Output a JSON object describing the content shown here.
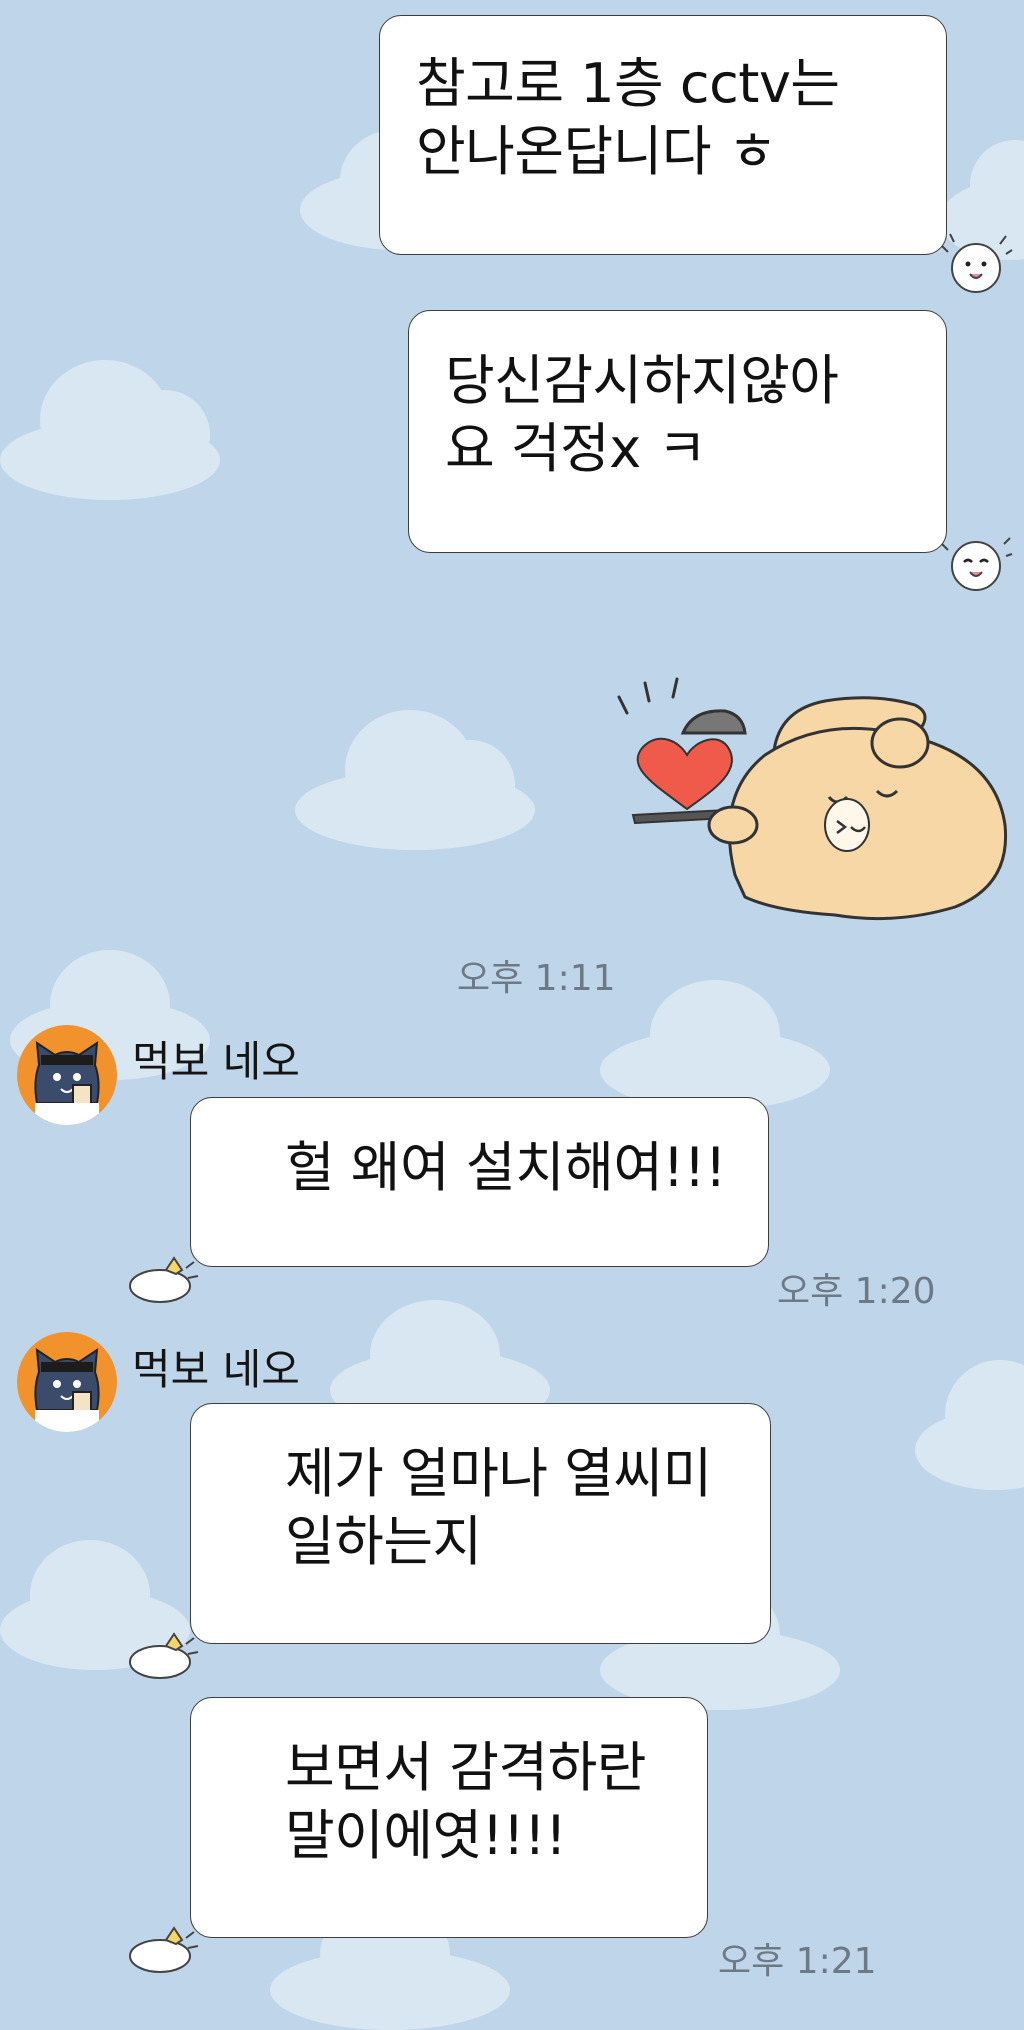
{
  "messages": {
    "sent": [
      {
        "lines": [
          "참고로 1층 cctv는",
          "안나온답니다 ㅎ"
        ]
      },
      {
        "lines": [
          "당신감시하지않아",
          "요 걱정x ㅋ"
        ]
      }
    ],
    "sent_time": "오후 1:11",
    "received": [
      {
        "sender": "먹보 네오",
        "lines": [
          "헐 왜여 설치해여!!!"
        ],
        "time": "오후 1:20"
      },
      {
        "sender": "먹보 네오",
        "lines": [
          "제가 얼마나 열씨미",
          "일하는지"
        ]
      },
      {
        "lines": [
          "보면서 감격하란",
          "말이에엿!!!!"
        ],
        "time": "오후 1:21"
      }
    ]
  },
  "sticker": {
    "name": "bear-serving-heart-sticker"
  },
  "colors": {
    "background": "#bfd6ea",
    "cloud": "#d9e7f3",
    "bubble": "#ffffff",
    "bubble_border": "#3d3d3d",
    "timestamp": "#6e7986",
    "avatar_bg": "#f1922c",
    "sticker_bear": "#f7d7a5",
    "sticker_heart": "#ef5a4a"
  }
}
